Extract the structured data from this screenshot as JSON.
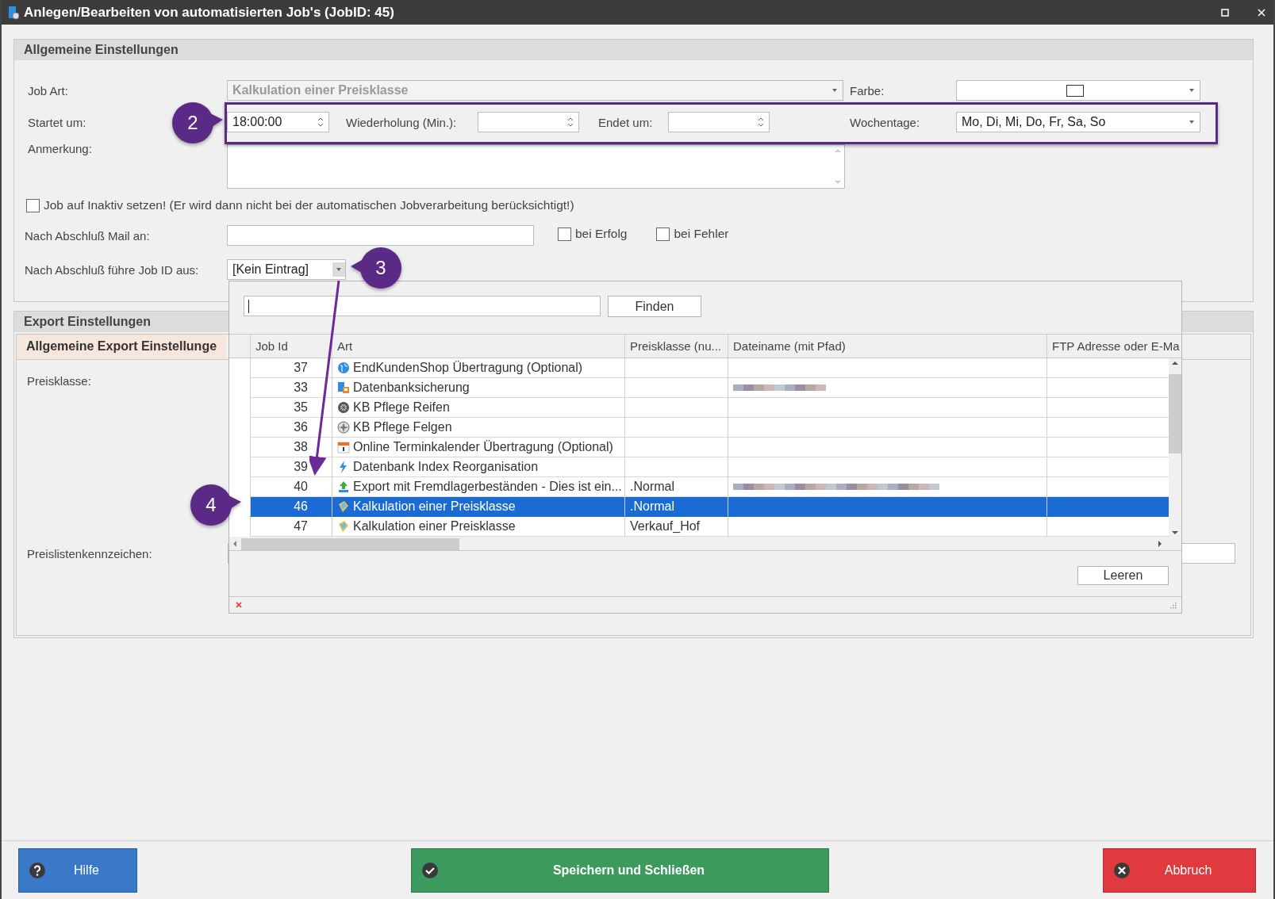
{
  "window": {
    "title": "Anlegen/Bearbeiten von automatisierten Job's (JobID: 45)"
  },
  "general": {
    "title": "Allgemeine Einstellungen",
    "job_art": {
      "label": "Job Art:",
      "value": "Kalkulation einer Preisklasse",
      "disabled": true
    },
    "farbe": {
      "label": "Farbe:"
    },
    "startet": {
      "label": "Startet um:",
      "value": "18:00:00"
    },
    "wiederholung": {
      "label": "Wiederholung (Min.):"
    },
    "endet": {
      "label": "Endet um:"
    },
    "wochentage": {
      "label": "Wochentage:",
      "value": "Mo, Di, Mi, Do, Fr, Sa, So"
    },
    "anmerkung": {
      "label": "Anmerkung:"
    },
    "inaktiv": {
      "label": "Job auf Inaktiv setzen! (Er wird dann nicht bei der automatischen Jobverarbeitung berücksichtigt!)",
      "checked": false
    },
    "mail": {
      "label": "Nach Abschluß Mail an:"
    },
    "mail_options": [
      {
        "label": "bei Erfolg",
        "checked": false
      },
      {
        "label": "bei Fehler",
        "checked": false
      }
    ],
    "next_job": {
      "label": "Nach Abschluß führe Job ID aus:",
      "value": "[Kein Eintrag]",
      "expanded": true
    }
  },
  "export": {
    "title": "Export Einstellungen",
    "tab": "Allgemeine Export Einstellunge",
    "preisklasse_label": "Preisklasse:",
    "kennzeichen_label": "Preislistenkennzeichen:"
  },
  "popup": {
    "find_button": "Finden",
    "clear_button": "Leeren",
    "columns": [
      "Job Id",
      "Art",
      "Preisklasse (nu...",
      "Dateiname (mit Pfad)",
      "FTP Adresse oder E-Ma"
    ],
    "rows": [
      {
        "id": "37",
        "kind": "globe",
        "art": "EndKundenShop Übertragung (Optional)",
        "preisklasse": "",
        "blurred": false,
        "selected": false
      },
      {
        "id": "33",
        "kind": "database",
        "art": "Datenbanksicherung",
        "preisklasse": "",
        "blurred": true,
        "selected": false
      },
      {
        "id": "35",
        "kind": "wheel",
        "art": "KB Pflege Reifen",
        "preisklasse": "",
        "blurred": false,
        "selected": false
      },
      {
        "id": "36",
        "kind": "rim",
        "art": "KB Pflege Felgen",
        "preisklasse": "",
        "blurred": false,
        "selected": false
      },
      {
        "id": "38",
        "kind": "calendar",
        "art": "Online Terminkalender Übertragung (Optional)",
        "preisklasse": "",
        "blurred": false,
        "selected": false
      },
      {
        "id": "39",
        "kind": "bolt",
        "art": "Datenbank Index Reorganisation",
        "preisklasse": "",
        "blurred": false,
        "selected": false
      },
      {
        "id": "40",
        "kind": "upload",
        "art": "Export mit Fremdlagerbeständen - Dies ist ein...",
        "preisklasse": ".Normal",
        "blurred": true,
        "selected": false
      },
      {
        "id": "46",
        "kind": "calc",
        "art": "Kalkulation einer Preisklasse",
        "preisklasse": ".Normal",
        "blurred": false,
        "selected": true
      },
      {
        "id": "47",
        "kind": "calc",
        "art": "Kalkulation einer Preisklasse",
        "preisklasse": "Verkauf_Hof",
        "blurred": false,
        "selected": false
      }
    ]
  },
  "footer": {
    "buttons": [
      {
        "kind": "help",
        "label": "Hilfe"
      },
      {
        "kind": "save",
        "label": "Speichern und Schließen"
      },
      {
        "kind": "cancel",
        "label": "Abbruch"
      }
    ]
  },
  "annotations": [
    {
      "label": "2",
      "kind": "right"
    },
    {
      "label": "3",
      "kind": "left"
    },
    {
      "label": "4",
      "kind": "right"
    }
  ]
}
